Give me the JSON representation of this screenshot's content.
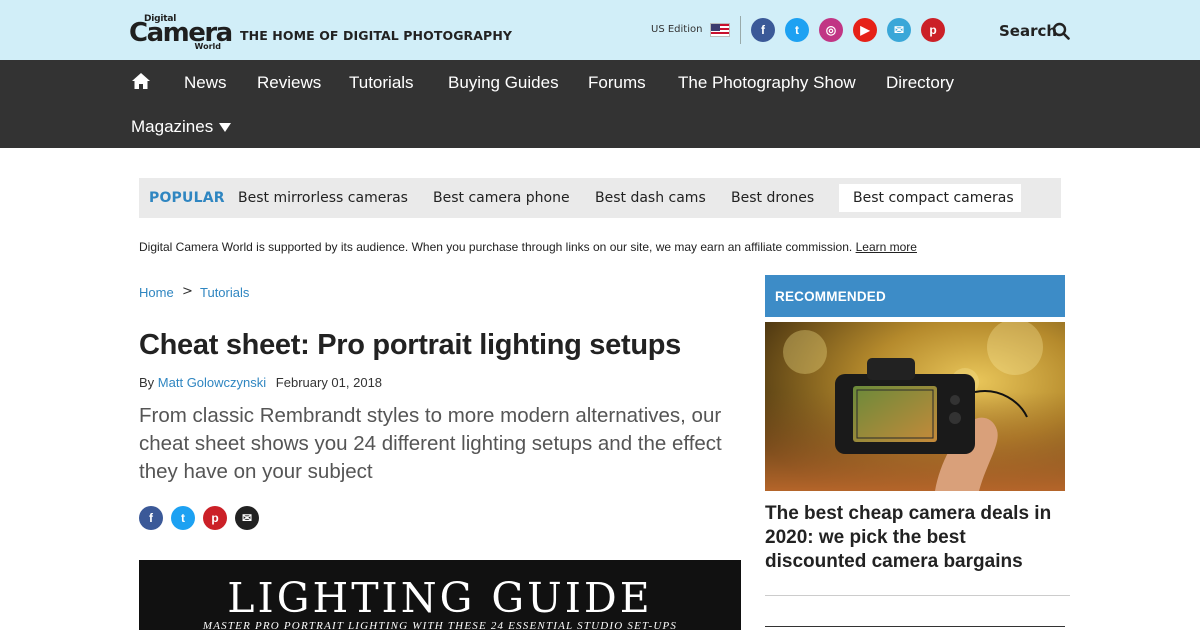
{
  "header": {
    "logo": {
      "top": "Digital",
      "main": "Camera",
      "bottom": "World"
    },
    "tagline": "THE HOME OF DIGITAL PHOTOGRAPHY",
    "edition": "US Edition",
    "social": [
      {
        "icon": "facebook-icon",
        "glyph": "f",
        "color": "#3b5998"
      },
      {
        "icon": "twitter-icon",
        "glyph": "t",
        "color": "#1da1f2"
      },
      {
        "icon": "instagram-icon",
        "glyph": "◎",
        "color": "#c13584"
      },
      {
        "icon": "youtube-icon",
        "glyph": "▶",
        "color": "#e62117"
      },
      {
        "icon": "email-icon",
        "glyph": "✉",
        "color": "#3aa7d8"
      },
      {
        "icon": "pinterest-icon",
        "glyph": "p",
        "color": "#cb2027"
      }
    ],
    "search_label": "Search"
  },
  "nav": {
    "items": [
      "News",
      "Reviews",
      "Tutorials",
      "Buying Guides",
      "Forums",
      "The Photography Show",
      "Directory"
    ],
    "magazines": "Magazines"
  },
  "popular": {
    "title": "POPULAR",
    "links": [
      "Best mirrorless cameras",
      "Best camera phone",
      "Best dash cams",
      "Best drones",
      "Best compact cameras"
    ],
    "active_index": 4
  },
  "affiliate": {
    "text": "Digital Camera World is supported by its audience. When you purchase through links on our site, we may earn an affiliate commission.",
    "link": "Learn more"
  },
  "article": {
    "breadcrumb": [
      "Home",
      "Tutorials"
    ],
    "breadcrumb_sep": ">",
    "headline": "Cheat sheet: Pro portrait lighting setups",
    "by": "By",
    "author": "Matt Golowczynski",
    "date": "February 01, 2018",
    "standfirst": "From classic Rembrandt styles to more modern alternatives, our cheat sheet shows you 24 different lighting setups and the effect they have on your subject",
    "share": [
      {
        "icon": "facebook-icon",
        "glyph": "f",
        "color": "#3b5998"
      },
      {
        "icon": "twitter-icon",
        "glyph": "t",
        "color": "#1da1f2"
      },
      {
        "icon": "pinterest-icon",
        "glyph": "p",
        "color": "#cb2027"
      },
      {
        "icon": "email-icon",
        "glyph": "✉",
        "color": "#222222"
      }
    ],
    "hero": {
      "title": "LIGHTING GUIDE",
      "subtitle": "MASTER PRO PORTRAIT LIGHTING WITH THESE 24 ESSENTIAL STUDIO SET-UPS"
    }
  },
  "sidebar": {
    "label": "RECOMMENDED",
    "title": "The best cheap camera deals in 2020: we pick the best discounted camera bargains"
  }
}
